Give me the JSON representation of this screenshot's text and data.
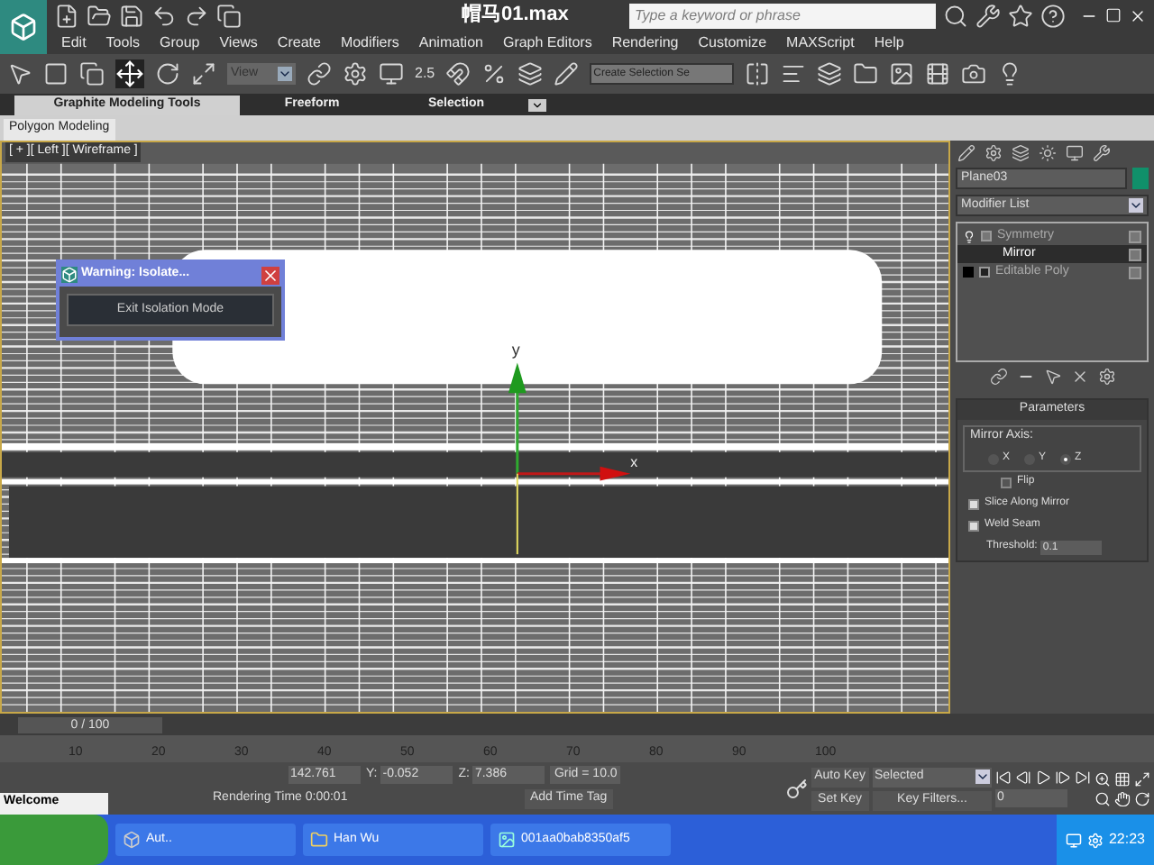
{
  "title_bar": {
    "title": "帽马01.max",
    "search_placeholder": "Type a keyword or phrase"
  },
  "menu": [
    "Edit",
    "Tools",
    "Group",
    "Views",
    "Create",
    "Modifiers",
    "Animation",
    "Graph Editors",
    "Rendering",
    "Customize",
    "MAXScript",
    "Help"
  ],
  "main_toolbar": {
    "view_dropdown": "View",
    "selection_set": "Create Selection Se",
    "snap_value": "2.5"
  },
  "ribbon": {
    "tabs": [
      {
        "label": "Graphite Modeling Tools",
        "selected": true
      },
      {
        "label": "Freeform",
        "selected": false
      },
      {
        "label": "Selection",
        "selected": false
      }
    ],
    "panel_tab": "Polygon Modeling"
  },
  "viewport": {
    "label": "[ + ][ Left ][ Wireframe ]",
    "axis_labels": [
      "y",
      "x"
    ],
    "dialog": {
      "title": "Warning: Isolate...",
      "button": "Exit Isolation Mode"
    }
  },
  "command_panel": {
    "object_name": "Plane03",
    "modifier_list": "Modifier List",
    "stack": [
      {
        "label": "Symmetry",
        "kind": "modifier",
        "expanded": true,
        "selected": false
      },
      {
        "label": "Mirror",
        "kind": "sub",
        "selected": true
      },
      {
        "label": "Editable Poly",
        "kind": "base",
        "expanded": false,
        "selected": false
      }
    ],
    "rollout": {
      "title": "Parameters",
      "group": "Mirror Axis:",
      "axes": [
        {
          "label": "X",
          "selected": false
        },
        {
          "label": "Y",
          "selected": false
        },
        {
          "label": "Z",
          "selected": true
        }
      ],
      "options": [
        {
          "label": "Flip",
          "checked": false,
          "kind": "indented"
        },
        {
          "label": "Slice Along Mirror",
          "checked": true,
          "kind": "plain"
        },
        {
          "label": "Weld Seam",
          "checked": true,
          "kind": "plain"
        }
      ],
      "threshold": {
        "label": "Threshold:",
        "value": "0.1"
      }
    }
  },
  "timeline": {
    "position": "0 / 100",
    "level": 0,
    "ticks": [
      "10",
      "20",
      "30",
      "40",
      "50",
      "60",
      "70",
      "80",
      "90",
      "100"
    ]
  },
  "status": {
    "prompt": "Welcome",
    "coords": [
      {
        "value": "142.761"
      },
      {
        "axis": "Y:",
        "value": "-0.052"
      },
      {
        "axis": "Z:",
        "value": "7.386"
      }
    ],
    "grid": "Grid = 10.0",
    "time_tag": "Add Time Tag",
    "rendering": "Rendering Time 0:00:01"
  },
  "animation": {
    "auto_key": "Auto Key",
    "set_key": "Set Key",
    "key_mode": "Selected",
    "key_filters": "Key Filters...",
    "frame": "0"
  },
  "taskbar": {
    "tasks": [
      {
        "label": "Aut..",
        "kind": "app"
      },
      {
        "label": "Han Wu",
        "kind": "folder"
      },
      {
        "label": "001aa0bab8350af5",
        "kind": "image"
      }
    ],
    "clock": "22:23"
  }
}
